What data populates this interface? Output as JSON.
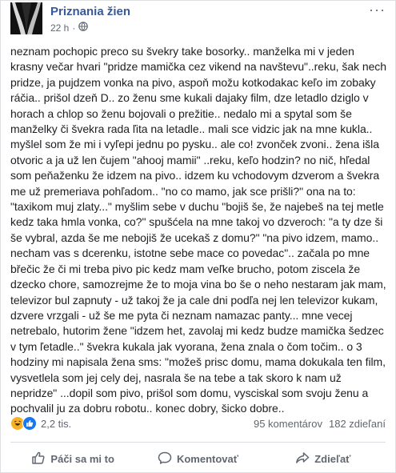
{
  "post": {
    "page_name": "Priznania žien",
    "time": "22 h",
    "separator": "·",
    "body_lines": [
      "neznam pochopic preco su švekry take bosorky.. manželka mi v jeden",
      "krasny večar hvari \"pridze mamička cez vikend na navštevu\"..reku, šak nech",
      "pridze, ja pujdzem vonka na pivo, aspoň možu kotkodakac keľo im zobaky",
      "ráčia.. prišol dzeň D.. zo ženu sme kukali dajaky film, dze letadlo dziglo v",
      "horach a chlop so ženu bojovali o prežitie.. nedalo mi a spytal som še",
      "manželky či švekra rada ľita na letadle.. mali sce vidzic jak na mne kukla..",
      "myšlel som že mi i vyľepi jednu po pysku.. ale co! zvonček zvoni.. žena išla",
      "otvoric a ja už len čujem \"ahooj mamii\" ..reku, keľo hodzin? no nič, hľedal",
      "som peňaženku že idzem na pivo.. idzem ku vchodovym dzverom a švekra",
      "me už premeriava pohľadom.. \"no co mamo, jak sce prišli?\" ona na to:",
      "\"taxikom muj zlaty...\" myšlim sebe v duchu \"bojiš še, že najebeš na tej metle",
      "kedz taka hmla vonka, co?\" spušćela na mne takoj vo dzveroch: \"a ty dze ši",
      "še vybral, azda še me nebojiš že ucekaš z domu?\" \"na pivo idzem, mamo..",
      "necham vas s dcerenku, istotne sebe mace co povedac\".. začala po mne",
      "břečic že či mi treba pivo pic kedz mam veľke brucho, potom ziscela že",
      "dzecko chore, samozrejme že to moja vina bo še o neho nestaram jak mam,",
      "televizor bul zapnuty - už takoj že ja cale dni podľa nej len televizor kukam,",
      "dzvere vrzgali - už še me pyta či neznam namazac panty... mne vecej",
      "netrebalo, hutorim žene \"idzem het, zavolaj mi kedz budze mamička šedzec",
      "v tym ľetadle..\" švekra kukala jak vyorana, žena znala o čom točim.. o 3",
      "hodziny mi napisala žena sms: \"možeš prisc domu, mama dokukala ten film,",
      "vysvetlela som jej cely dej, nasrala še na tebe a tak skoro k nam už",
      "nepridze\" ...dopil som pivo, prišol som domu, vysciskal som svoju ženu a",
      "pochvalil ju za dobru robotu.. konec dobry, šicko dobre.."
    ]
  },
  "reactions": {
    "count": "2,2 tis.",
    "comments": "95 komentárov",
    "shares": "182 zdieľaní",
    "icons": [
      "haha-icon",
      "like-icon"
    ]
  },
  "actions": {
    "like": "Páči sa mi to",
    "comment": "Komentovať",
    "share": "Zdieľať"
  },
  "colors": {
    "page_name": "#385898",
    "meta": "#606770",
    "like_blue": "#1877f2",
    "haha_yellow": "#f7b125"
  }
}
